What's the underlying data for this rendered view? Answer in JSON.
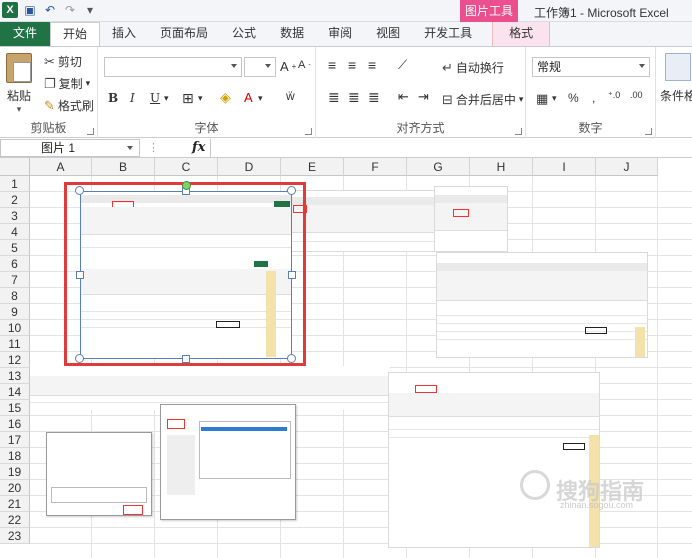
{
  "window": {
    "title": "工作簿1 - Microsoft Excel",
    "context_tool": "图片工具"
  },
  "tabs": [
    "文件",
    "开始",
    "插入",
    "页面布局",
    "公式",
    "数据",
    "审阅",
    "视图",
    "开发工具",
    "格式"
  ],
  "ribbon": {
    "clipboard": {
      "paste": "粘贴",
      "cut": "剪切",
      "copy": "复制",
      "format_painter": "格式刷",
      "label": "剪贴板"
    },
    "font": {
      "bold": "B",
      "italic": "I",
      "underline": "U",
      "label": "字体"
    },
    "alignment": {
      "wrap_text": "自动换行",
      "merge_center": "合并后居中",
      "label": "对齐方式"
    },
    "number": {
      "format_value": "常规",
      "percent": "%",
      "comma": ",",
      "label": "数字"
    },
    "styles": {
      "conditional": "条件格"
    }
  },
  "formula_bar": {
    "name_box": "图片 1",
    "fx": "fx"
  },
  "grid": {
    "columns": [
      "A",
      "B",
      "C",
      "D",
      "E",
      "F",
      "G",
      "H",
      "I",
      "J"
    ],
    "rows": [
      "1",
      "2",
      "3",
      "4",
      "5",
      "6",
      "7",
      "8",
      "9",
      "10",
      "11",
      "12",
      "13",
      "14",
      "15",
      "16",
      "17",
      "18",
      "19",
      "20",
      "21",
      "22",
      "23"
    ]
  },
  "watermark": {
    "text": "搜狗指南",
    "url": "zhinan.sogou.com"
  },
  "icons": {
    "excel_logo": "X",
    "save": "💾",
    "undo": "↶",
    "redo": "↷"
  },
  "colors": {
    "file_tab": "#217346",
    "picture_tools": "#e9508d",
    "highlight_frame": "#e03b3b",
    "selection": "#5a7fb8"
  }
}
